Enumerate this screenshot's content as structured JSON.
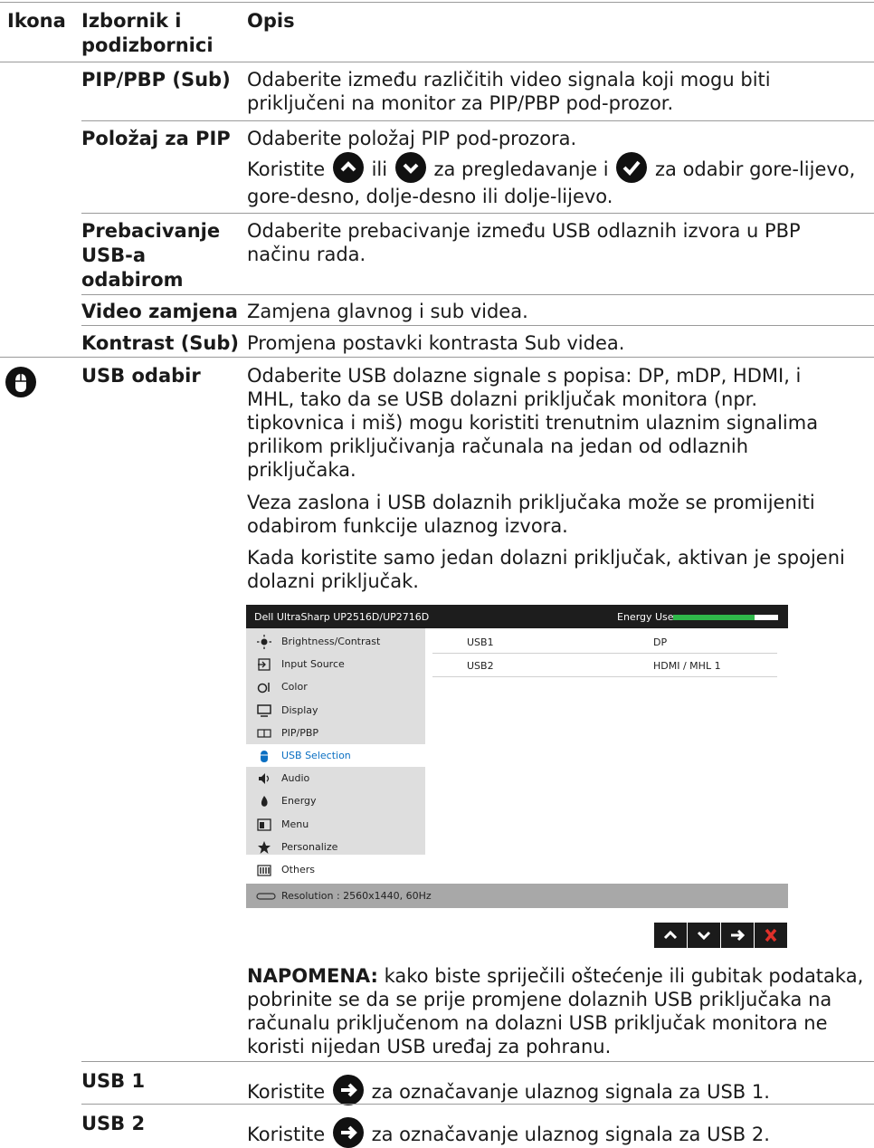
{
  "header": {
    "col_icon": "Ikona",
    "col_menu": "Izbornik i podizbornici",
    "col_desc": "Opis"
  },
  "rows": {
    "pip_sub": {
      "name": "PIP/PBP (Sub)",
      "desc": "Odaberite između različitih video signala koji mogu biti priključeni na monitor za PIP/PBP pod-prozor."
    },
    "pip_pos": {
      "name": "Položaj za PIP",
      "desc1": "Odaberite položaj PIP pod-prozora.",
      "desc2_a": "Koristite",
      "desc2_b": "ili",
      "desc2_c": "za pregledavanje i",
      "desc2_d": "za odabir gore-lijevo,",
      "desc2_e": "gore-desno, dolje-desno ili dolje-lijevo."
    },
    "usb_switch": {
      "name": "Prebacivanje USB-a odabirom",
      "desc": "Odaberite prebacivanje između USB odlaznih izvora u PBP načinu rada."
    },
    "video_swap": {
      "name": "Video zamjena",
      "desc": "Zamjena glavnog i sub videa."
    },
    "contrast_sub": {
      "name": "Kontrast (Sub)",
      "desc": "Promjena postavki kontrasta Sub videa."
    },
    "usb_select": {
      "name": "USB odabir",
      "p1": "Odaberite USB dolazne signale s popisa: DP, mDP, HDMI, i MHL, tako da se USB dolazni priključak monitora (npr. tipkovnica i miš) mogu koristiti trenutnim ulaznim signalima prilikom priključivanja računala na jedan od odlaznih priključaka.",
      "p2": "Veza zaslona i USB dolaznih priključaka može se promijeniti odabirom funkcije ulaznog izvora.",
      "p3": "Kada koristite samo jedan dolazni priključak, aktivan je spojeni dolazni priključak.",
      "note_label": "NAPOMENA:",
      "note_text": " kako biste spriječili oštećenje ili gubitak podataka, pobrinite se da se prije promjene dolaznih USB priključaka na računalu priključenom na dolazni USB priključak monitora ne koristi nijedan USB uređaj za pohranu."
    },
    "usb1": {
      "name": "USB 1",
      "desc_a": "Koristite",
      "desc_b": "za označavanje ulaznog signala za USB 1."
    },
    "usb2": {
      "name": "USB 2",
      "desc_a": "Koristite",
      "desc_b": "za označavanje ulaznog signala za USB 2."
    }
  },
  "osd": {
    "title": "Dell UltraSharp UP2516D/UP2716D",
    "energy_label": "Energy Use",
    "energy_level": 0.78,
    "menu": [
      "Brightness/Contrast",
      "Input Source",
      "Color",
      "Display",
      "PIP/PBP",
      "USB Selection",
      "Audio",
      "Energy",
      "Menu",
      "Personalize",
      "Others"
    ],
    "selected_index": 5,
    "options": [
      {
        "label": "USB1",
        "value": "DP"
      },
      {
        "label": "USB2",
        "value": "HDMI / MHL 1"
      }
    ],
    "resolution": "Resolution : 2560x1440, 60Hz"
  },
  "colors": {
    "accent": "#0a6fc2",
    "osd_bg": "#dedede",
    "osd_header": "#1d1d1d",
    "footer": "#a8a8a8",
    "close": "#e0302a"
  },
  "icons": [
    "mouse-icon",
    "chevron-up-icon",
    "chevron-down-icon",
    "check-icon",
    "arrow-right-icon",
    "close-icon"
  ]
}
